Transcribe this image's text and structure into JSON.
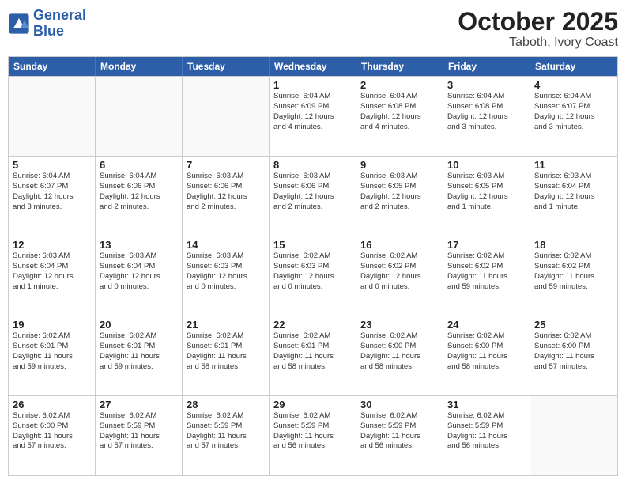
{
  "logo": {
    "line1": "General",
    "line2": "Blue"
  },
  "title": "October 2025",
  "location": "Taboth, Ivory Coast",
  "dayHeaders": [
    "Sunday",
    "Monday",
    "Tuesday",
    "Wednesday",
    "Thursday",
    "Friday",
    "Saturday"
  ],
  "rows": [
    [
      {
        "day": "",
        "info": ""
      },
      {
        "day": "",
        "info": ""
      },
      {
        "day": "",
        "info": ""
      },
      {
        "day": "1",
        "info": "Sunrise: 6:04 AM\nSunset: 6:09 PM\nDaylight: 12 hours\nand 4 minutes."
      },
      {
        "day": "2",
        "info": "Sunrise: 6:04 AM\nSunset: 6:08 PM\nDaylight: 12 hours\nand 4 minutes."
      },
      {
        "day": "3",
        "info": "Sunrise: 6:04 AM\nSunset: 6:08 PM\nDaylight: 12 hours\nand 3 minutes."
      },
      {
        "day": "4",
        "info": "Sunrise: 6:04 AM\nSunset: 6:07 PM\nDaylight: 12 hours\nand 3 minutes."
      }
    ],
    [
      {
        "day": "5",
        "info": "Sunrise: 6:04 AM\nSunset: 6:07 PM\nDaylight: 12 hours\nand 3 minutes."
      },
      {
        "day": "6",
        "info": "Sunrise: 6:04 AM\nSunset: 6:06 PM\nDaylight: 12 hours\nand 2 minutes."
      },
      {
        "day": "7",
        "info": "Sunrise: 6:03 AM\nSunset: 6:06 PM\nDaylight: 12 hours\nand 2 minutes."
      },
      {
        "day": "8",
        "info": "Sunrise: 6:03 AM\nSunset: 6:06 PM\nDaylight: 12 hours\nand 2 minutes."
      },
      {
        "day": "9",
        "info": "Sunrise: 6:03 AM\nSunset: 6:05 PM\nDaylight: 12 hours\nand 2 minutes."
      },
      {
        "day": "10",
        "info": "Sunrise: 6:03 AM\nSunset: 6:05 PM\nDaylight: 12 hours\nand 1 minute."
      },
      {
        "day": "11",
        "info": "Sunrise: 6:03 AM\nSunset: 6:04 PM\nDaylight: 12 hours\nand 1 minute."
      }
    ],
    [
      {
        "day": "12",
        "info": "Sunrise: 6:03 AM\nSunset: 6:04 PM\nDaylight: 12 hours\nand 1 minute."
      },
      {
        "day": "13",
        "info": "Sunrise: 6:03 AM\nSunset: 6:04 PM\nDaylight: 12 hours\nand 0 minutes."
      },
      {
        "day": "14",
        "info": "Sunrise: 6:03 AM\nSunset: 6:03 PM\nDaylight: 12 hours\nand 0 minutes."
      },
      {
        "day": "15",
        "info": "Sunrise: 6:02 AM\nSunset: 6:03 PM\nDaylight: 12 hours\nand 0 minutes."
      },
      {
        "day": "16",
        "info": "Sunrise: 6:02 AM\nSunset: 6:02 PM\nDaylight: 12 hours\nand 0 minutes."
      },
      {
        "day": "17",
        "info": "Sunrise: 6:02 AM\nSunset: 6:02 PM\nDaylight: 11 hours\nand 59 minutes."
      },
      {
        "day": "18",
        "info": "Sunrise: 6:02 AM\nSunset: 6:02 PM\nDaylight: 11 hours\nand 59 minutes."
      }
    ],
    [
      {
        "day": "19",
        "info": "Sunrise: 6:02 AM\nSunset: 6:01 PM\nDaylight: 11 hours\nand 59 minutes."
      },
      {
        "day": "20",
        "info": "Sunrise: 6:02 AM\nSunset: 6:01 PM\nDaylight: 11 hours\nand 59 minutes."
      },
      {
        "day": "21",
        "info": "Sunrise: 6:02 AM\nSunset: 6:01 PM\nDaylight: 11 hours\nand 58 minutes."
      },
      {
        "day": "22",
        "info": "Sunrise: 6:02 AM\nSunset: 6:01 PM\nDaylight: 11 hours\nand 58 minutes."
      },
      {
        "day": "23",
        "info": "Sunrise: 6:02 AM\nSunset: 6:00 PM\nDaylight: 11 hours\nand 58 minutes."
      },
      {
        "day": "24",
        "info": "Sunrise: 6:02 AM\nSunset: 6:00 PM\nDaylight: 11 hours\nand 58 minutes."
      },
      {
        "day": "25",
        "info": "Sunrise: 6:02 AM\nSunset: 6:00 PM\nDaylight: 11 hours\nand 57 minutes."
      }
    ],
    [
      {
        "day": "26",
        "info": "Sunrise: 6:02 AM\nSunset: 6:00 PM\nDaylight: 11 hours\nand 57 minutes."
      },
      {
        "day": "27",
        "info": "Sunrise: 6:02 AM\nSunset: 5:59 PM\nDaylight: 11 hours\nand 57 minutes."
      },
      {
        "day": "28",
        "info": "Sunrise: 6:02 AM\nSunset: 5:59 PM\nDaylight: 11 hours\nand 57 minutes."
      },
      {
        "day": "29",
        "info": "Sunrise: 6:02 AM\nSunset: 5:59 PM\nDaylight: 11 hours\nand 56 minutes."
      },
      {
        "day": "30",
        "info": "Sunrise: 6:02 AM\nSunset: 5:59 PM\nDaylight: 11 hours\nand 56 minutes."
      },
      {
        "day": "31",
        "info": "Sunrise: 6:02 AM\nSunset: 5:59 PM\nDaylight: 11 hours\nand 56 minutes."
      },
      {
        "day": "",
        "info": ""
      }
    ]
  ]
}
